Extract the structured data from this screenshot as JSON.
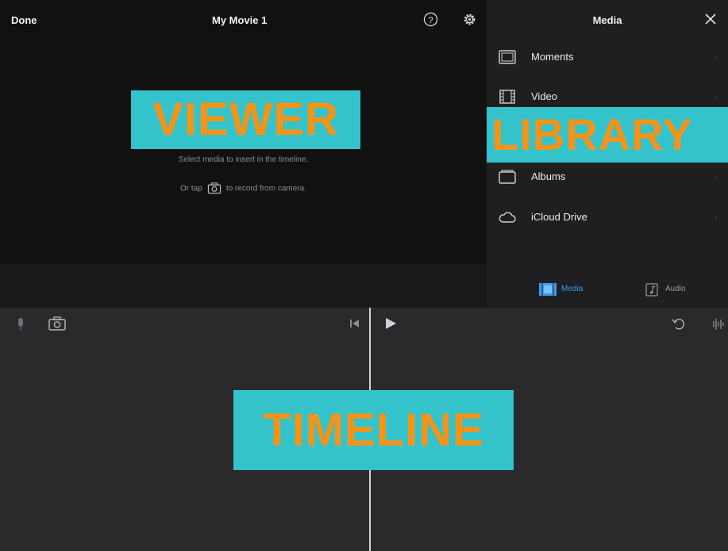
{
  "viewer": {
    "done_label": "Done",
    "title": "My Movie 1",
    "hint_line1": "Select media to insert in the timeline.",
    "hint_line2_before": "Or tap",
    "hint_line2_after": "to record from camera."
  },
  "library": {
    "title": "Media",
    "items": [
      {
        "label": "Moments",
        "icon": "moments-icon"
      },
      {
        "label": "Video",
        "icon": "video-film-icon"
      },
      {
        "label": "",
        "icon": "photos-icon"
      },
      {
        "label": "Albums",
        "icon": "albums-icon"
      },
      {
        "label": "iCloud Drive",
        "icon": "cloud-icon"
      }
    ],
    "tabs": [
      {
        "label": "Media",
        "active": true
      },
      {
        "label": "Audio",
        "active": false
      }
    ]
  },
  "overlays": {
    "viewer_label": "VIEWER",
    "library_label": "LIBRARY",
    "timeline_label": "TIMELINE"
  },
  "colors": {
    "overlay_bg": "#34c3cb",
    "overlay_text": "#f39419",
    "accent": "#3b9cf0"
  }
}
